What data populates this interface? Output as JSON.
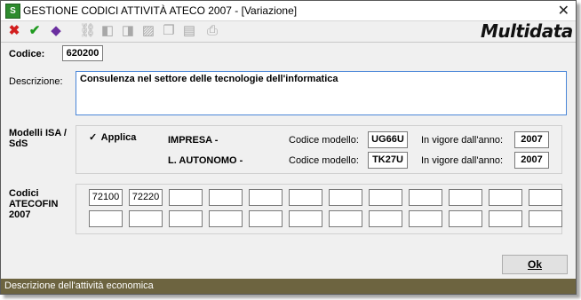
{
  "window": {
    "title": "GESTIONE CODICI ATTIVITÀ ATECO 2007 - [Variazione]",
    "app_icon": "S",
    "close_glyph": "✕"
  },
  "toolbar": {
    "icons": [
      "cancel-icon",
      "confirm-icon",
      "tag-icon",
      "binoculars-icon",
      "prev-doc-icon",
      "next-doc-icon",
      "delete-doc-icon",
      "copy-doc-icon",
      "paste-doc-icon",
      "print-icon"
    ]
  },
  "logo": {
    "text": "Multidata"
  },
  "codice": {
    "label": "Codice:",
    "value": "620200"
  },
  "descrizione": {
    "label": "Descrizione:",
    "value": "Consulenza nel settore delle tecnologie dell'informatica"
  },
  "modelli": {
    "label_line1": "Modelli ISA /",
    "label_line2": "SdS",
    "applica_label": "Applica",
    "applica_checked": true,
    "impresa": {
      "label": "IMPRESA -",
      "codice_label": "Codice modello:",
      "codice_value": "UG66U",
      "vigore_label": "In vigore dall'anno:",
      "vigore_value": "2007"
    },
    "autonomo": {
      "label": "L. AUTONOMO -",
      "codice_label": "Codice modello:",
      "codice_value": "TK27U",
      "vigore_label": "In vigore dall'anno:",
      "vigore_value": "2007"
    }
  },
  "atecofin": {
    "label_line1": "Codici",
    "label_line2": "ATECOFIN",
    "label_line3": "2007",
    "row1": [
      "72100",
      "72220",
      "",
      "",
      "",
      "",
      "",
      "",
      "",
      "",
      "",
      ""
    ],
    "row2": [
      "",
      "",
      "",
      "",
      "",
      "",
      "",
      "",
      "",
      "",
      "",
      ""
    ]
  },
  "ok_button": "Ok",
  "status": "Descrizione dell'attività economica"
}
